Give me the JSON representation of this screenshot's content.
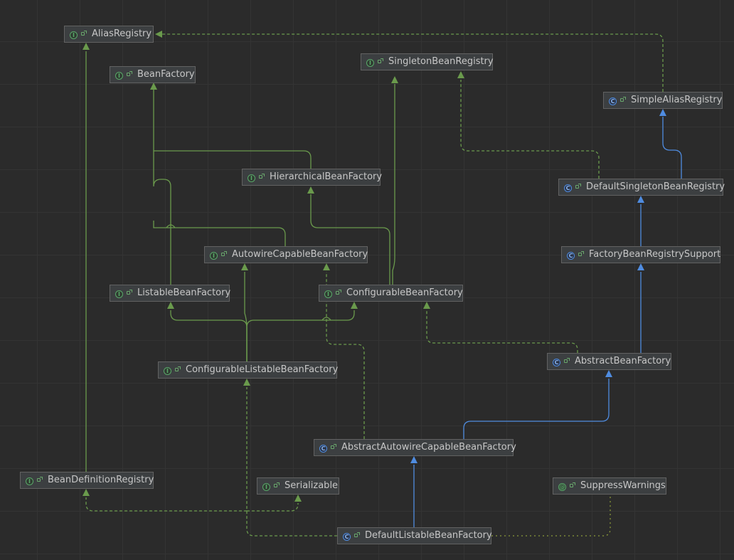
{
  "colors": {
    "implements": "#6a9a4c",
    "extends": "#4f8ce0",
    "usage": "#8a9a3a",
    "node_bg": "#3c3f41",
    "node_border": "#626262",
    "text": "#c7c7c7"
  },
  "nodes": {
    "alias_registry": {
      "label": "AliasRegistry",
      "kind": "interface",
      "kind_glyph": "I"
    },
    "bean_factory": {
      "label": "BeanFactory",
      "kind": "interface",
      "kind_glyph": "I"
    },
    "singleton_bean_registry": {
      "label": "SingletonBeanRegistry",
      "kind": "interface",
      "kind_glyph": "I"
    },
    "simple_alias_registry": {
      "label": "SimpleAliasRegistry",
      "kind": "class",
      "kind_glyph": "C"
    },
    "hierarchical_bean_factory": {
      "label": "HierarchicalBeanFactory",
      "kind": "interface",
      "kind_glyph": "I"
    },
    "default_singleton_bean_registry": {
      "label": "DefaultSingletonBeanRegistry",
      "kind": "class",
      "kind_glyph": "C"
    },
    "autowire_capable_bean_factory": {
      "label": "AutowireCapableBeanFactory",
      "kind": "interface",
      "kind_glyph": "I"
    },
    "factory_bean_registry_support": {
      "label": "FactoryBeanRegistrySupport",
      "kind": "class",
      "kind_glyph": "C"
    },
    "listable_bean_factory": {
      "label": "ListableBeanFactory",
      "kind": "interface",
      "kind_glyph": "I"
    },
    "configurable_bean_factory": {
      "label": "ConfigurableBeanFactory",
      "kind": "interface",
      "kind_glyph": "I"
    },
    "abstract_bean_factory": {
      "label": "AbstractBeanFactory",
      "kind": "class",
      "kind_glyph": "C"
    },
    "configurable_listable_bean_factory": {
      "label": "ConfigurableListableBeanFactory",
      "kind": "interface",
      "kind_glyph": "I"
    },
    "abstract_autowire_capable_bean_factory": {
      "label": "AbstractAutowireCapableBeanFactory",
      "kind": "class",
      "kind_glyph": "C"
    },
    "bean_definition_registry": {
      "label": "BeanDefinitionRegistry",
      "kind": "interface",
      "kind_glyph": "I"
    },
    "serializable": {
      "label": "Serializable",
      "kind": "interface",
      "kind_glyph": "I"
    },
    "suppress_warnings": {
      "label": "SuppressWarnings",
      "kind": "annotation",
      "kind_glyph": "@"
    },
    "default_listable_bean_factory": {
      "label": "DefaultListableBeanFactory",
      "kind": "class",
      "kind_glyph": "C"
    }
  }
}
